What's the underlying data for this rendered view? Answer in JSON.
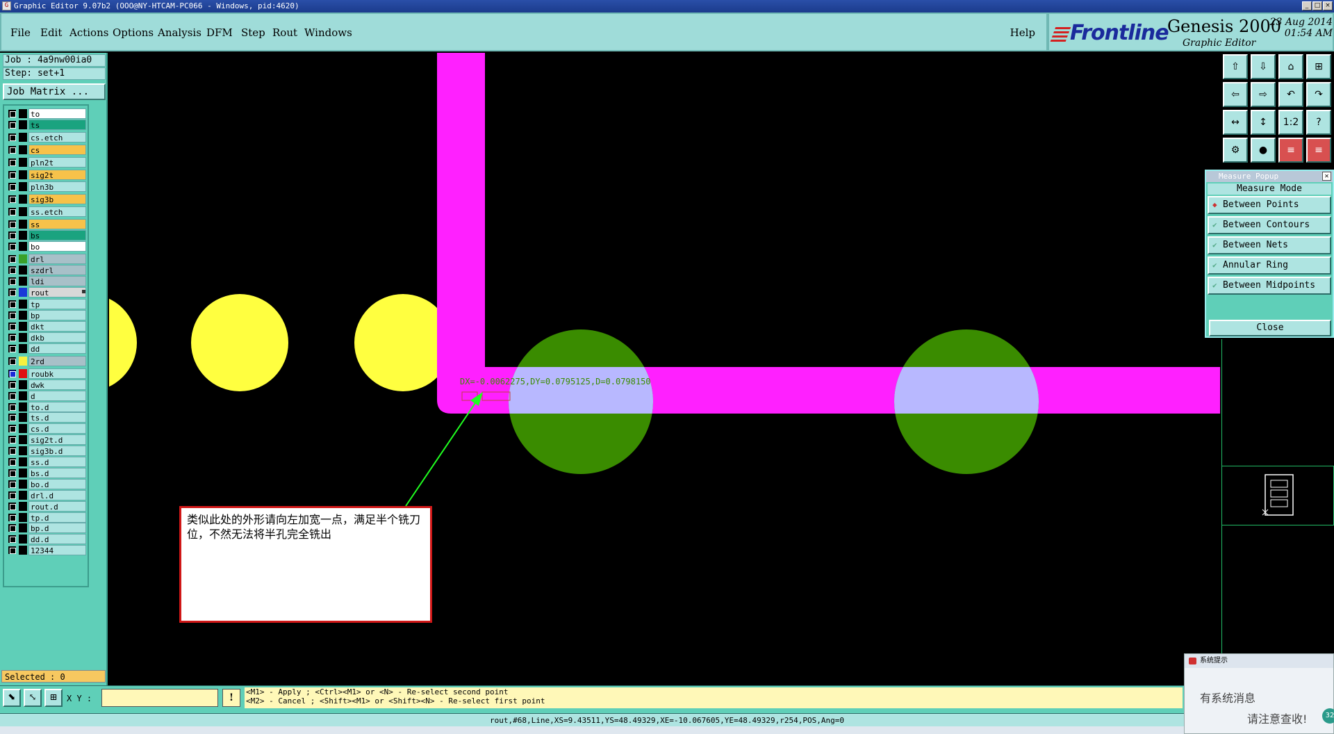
{
  "window": {
    "title": "Graphic Editor 9.07b2 (OOO@NY-HTCAM-PC066 - Windows, pid:4620)",
    "controls": [
      "_",
      "□",
      "×"
    ]
  },
  "menu": {
    "items": [
      "File",
      "Edit",
      "Actions",
      "Options",
      "Analysis",
      "DFM",
      "Step",
      "Rout",
      "Windows"
    ],
    "help": "Help"
  },
  "logo": {
    "brand": "Frontline",
    "product": "Genesis 2000",
    "subtitle": "Graphic Editor",
    "date": "23 Aug 2014",
    "time": "01:54 AM"
  },
  "job": {
    "job_label": "Job : 4a9nw00ia0",
    "step_label": "Step: set+1",
    "matrix_button": "Job Matrix ..."
  },
  "layers": [
    {
      "name": "to",
      "bg": "#ffffff",
      "color": "#000000"
    },
    {
      "name": "ts",
      "bg": "#1aa37f",
      "color": "#000000"
    },
    {
      "name": "cs.etch",
      "bg": "#aee4e1",
      "color": "#000000",
      "gap": true
    },
    {
      "name": "cs",
      "bg": "#f7c24a",
      "color": "#000000",
      "gap": true
    },
    {
      "name": "pln2t",
      "bg": "#aee4e1",
      "color": "#000000",
      "gap": true
    },
    {
      "name": "sig2t",
      "bg": "#f7c24a",
      "color": "#000000",
      "gap": true
    },
    {
      "name": "pln3b",
      "bg": "#aee4e1",
      "color": "#000000",
      "gap": true
    },
    {
      "name": "sig3b",
      "bg": "#f7c24a",
      "color": "#000000",
      "gap": true
    },
    {
      "name": "ss.etch",
      "bg": "#aee4e1",
      "color": "#000000",
      "gap": true
    },
    {
      "name": "ss",
      "bg": "#f7c24a",
      "color": "#000000",
      "gap": true
    },
    {
      "name": "bs",
      "bg": "#1aa37f",
      "color": "#000000"
    },
    {
      "name": "bo",
      "bg": "#ffffff",
      "color": "#000000"
    },
    {
      "name": "drl",
      "bg": "#a8c0c8",
      "color": "#3aa02a",
      "gap": true
    },
    {
      "name": "szdrl",
      "bg": "#a8c0c8",
      "color": "#000000"
    },
    {
      "name": "ldi",
      "bg": "#a8c0c8",
      "color": "#000000"
    },
    {
      "name": "rout",
      "bg": "#d8d8d8",
      "color": "#1a3ad8",
      "marker": true
    },
    {
      "name": "tp",
      "bg": "#aee4e1",
      "color": "#000000",
      "gap": true
    },
    {
      "name": "bp",
      "bg": "#aee4e1",
      "color": "#000000"
    },
    {
      "name": "dkt",
      "bg": "#aee4e1",
      "color": "#000000"
    },
    {
      "name": "dkb",
      "bg": "#aee4e1",
      "color": "#000000"
    },
    {
      "name": "dd",
      "bg": "#aee4e1",
      "color": "#000000"
    },
    {
      "name": "2rd",
      "bg": "#a8c0c8",
      "color": "#f8f040",
      "gap": true
    },
    {
      "name": "roubk",
      "bg": "#aee4e1",
      "color": "#e01010",
      "gap": true,
      "active": true
    },
    {
      "name": "dwk",
      "bg": "#aee4e1",
      "color": "#000000"
    },
    {
      "name": "d",
      "bg": "#aee4e1",
      "color": "#000000"
    },
    {
      "name": "to.d",
      "bg": "#aee4e1",
      "color": "#000000"
    },
    {
      "name": "ts.d",
      "bg": "#aee4e1",
      "color": "#000000"
    },
    {
      "name": "cs.d",
      "bg": "#aee4e1",
      "color": "#000000"
    },
    {
      "name": "sig2t.d",
      "bg": "#aee4e1",
      "color": "#000000"
    },
    {
      "name": "sig3b.d",
      "bg": "#aee4e1",
      "color": "#000000"
    },
    {
      "name": "ss.d",
      "bg": "#aee4e1",
      "color": "#000000"
    },
    {
      "name": "bs.d",
      "bg": "#aee4e1",
      "color": "#000000"
    },
    {
      "name": "bo.d",
      "bg": "#aee4e1",
      "color": "#000000"
    },
    {
      "name": "drl.d",
      "bg": "#aee4e1",
      "color": "#000000"
    },
    {
      "name": "rout.d",
      "bg": "#aee4e1",
      "color": "#000000"
    },
    {
      "name": "tp.d",
      "bg": "#aee4e1",
      "color": "#000000"
    },
    {
      "name": "bp.d",
      "bg": "#aee4e1",
      "color": "#000000"
    },
    {
      "name": "dd.d",
      "bg": "#aee4e1",
      "color": "#000000"
    },
    {
      "name": "12344",
      "bg": "#aee4e1",
      "color": "#000000"
    }
  ],
  "selected": "Selected : 0",
  "toolbox": {
    "icons": [
      "layer-up-icon",
      "layer-down-icon",
      "home-icon",
      "window-split-icon",
      "pan-left-icon",
      "pan-right-icon",
      "undo-view-icon",
      "redo-view-icon",
      "fit-horizontal-icon",
      "fit-vertical-icon",
      "scale-1-2-icon",
      "help-icon",
      "snap-icon",
      "probe-icon",
      "net-highlight-icon",
      "net-compare-icon"
    ],
    "glyphs": [
      "⇧",
      "⇩",
      "⌂",
      "⊞",
      "⇦",
      "⇨",
      "↶",
      "↷",
      "↔",
      "↕",
      "1:2",
      "?",
      "⚙",
      "●",
      "≡",
      "≡"
    ]
  },
  "measure": {
    "title": "Measure Popup",
    "mode_label": "Measure Mode",
    "options": [
      "Between Points",
      "Between Contours",
      "Between Nets",
      "Annular Ring",
      "Between Midpoints"
    ],
    "selected_index": 0,
    "close": "Close"
  },
  "canvas": {
    "measure_readout": "DX=-0.0062275,DY=0.0795125,D=0.0798150"
  },
  "annotation": {
    "text": "类似此处的外形请向左加宽一点，满足半个铣刀位，不然无法将半孔完全铣出"
  },
  "bottom": {
    "xy_label": "X Y :",
    "xy_value": "",
    "excl": "!",
    "hint1": "<M1> - Apply  ; <Ctrl><M1> or <N> - Re-select second point",
    "hint2": "<M2> - Cancel ; <Shift><M1> or <Shift><N> - Re-select first point"
  },
  "status": "rout,#68,Line,XS=9.43511,YS=48.49329,XE=-10.067605,YE=48.49329,r254,POS,Ang=0",
  "notification": {
    "header": "系统提示",
    "line1": "有系统消息",
    "line2": "请注意查收!",
    "badge": "32"
  },
  "colors": {
    "pad_yellow": "#ffff40",
    "trace_magenta": "#ff20ff",
    "pad_green": "#3a8c00",
    "overlap": "#b8b8ff",
    "cyan": "#10d0d0"
  }
}
